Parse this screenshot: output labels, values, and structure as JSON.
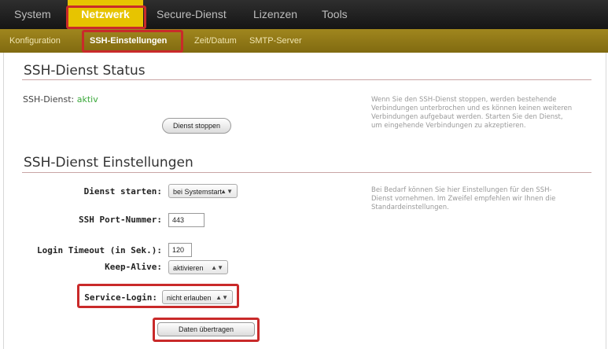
{
  "topnav": {
    "items": [
      "System",
      "Netzwerk",
      "Secure-Dienst",
      "Lizenzen",
      "Tools"
    ]
  },
  "subnav": {
    "items": [
      "Konfiguration",
      "SSH-Einstellungen",
      "Zeit/Datum",
      "SMTP-Server"
    ]
  },
  "status_section": {
    "title": "SSH-Dienst Status",
    "status_label": "SSH-Dienst:",
    "status_value": "aktiv",
    "stop_button": "Dienst stoppen",
    "help": "Wenn Sie den SSH-Dienst stoppen, werden bestehende Verbindungen unterbrochen und es können keinen weiteren Verbindungen aufgebaut werden. Starten Sie den Dienst, um eingehende Verbindungen zu akzeptieren."
  },
  "settings_section": {
    "title": "SSH-Dienst Einstellungen",
    "start_label": "Dienst starten:",
    "start_value": "bei Systemstart",
    "port_label": "SSH Port-Nummer:",
    "port_value": "443",
    "timeout_label": "Login Timeout (in Sek.):",
    "timeout_value": "120",
    "keepalive_label": "Keep-Alive:",
    "keepalive_value": "aktivieren",
    "service_login_label": "Service-Login:",
    "service_login_value": "nicht erlauben",
    "submit_button": "Daten übertragen",
    "help": "Bei Bedarf können Sie hier Einstellungen für den SSH-Dienst vornehmen. Im Zweifel empfehlen wir Ihnen die Standardeinstellungen."
  },
  "colors": {
    "accent_yellow": "#e7c400",
    "subbar_olive": "#8f7715",
    "highlight_red": "#c92a2a",
    "status_green": "#3aa83a"
  }
}
